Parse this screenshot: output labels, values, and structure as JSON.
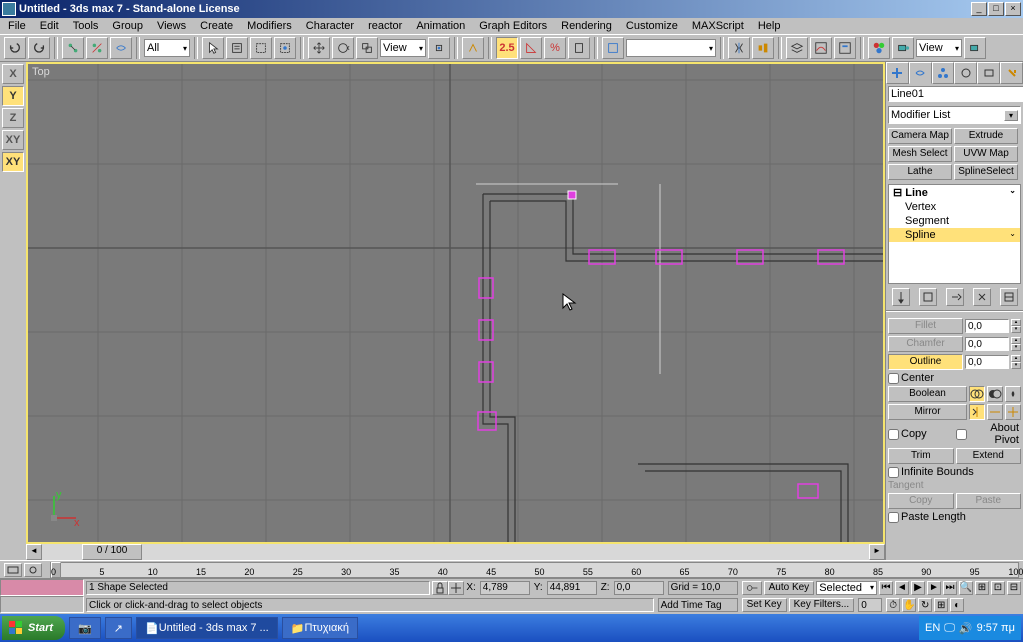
{
  "title": "Untitled - 3ds max 7  - Stand-alone License",
  "menus": [
    "File",
    "Edit",
    "Tools",
    "Group",
    "Views",
    "Create",
    "Modifiers",
    "Character",
    "reactor",
    "Animation",
    "Graph Editors",
    "Rendering",
    "Customize",
    "MAXScript",
    "Help"
  ],
  "toolbar": {
    "sets_dropdown": "All",
    "view_dropdown1": "View",
    "snap_value": "2.5",
    "named_selection": "",
    "view_dropdown2": "View"
  },
  "axis_buttons": [
    "X",
    "Y",
    "Z",
    "XY",
    "XY"
  ],
  "viewport": {
    "label": "Top"
  },
  "command_panel": {
    "object_name": "Line01",
    "modifier_list_label": "Modifier List",
    "quick_buttons": [
      "Camera Map",
      "Extrude",
      "Mesh Select",
      "UVW Map",
      "Lathe",
      "SplineSelect"
    ],
    "stack": {
      "root": "Line",
      "items": [
        "Vertex",
        "Segment",
        "Spline"
      ],
      "selected": "Spline"
    },
    "fillet": {
      "label": "Fillet",
      "value": "0,0"
    },
    "chamfer": {
      "label": "Chamfer",
      "value": "0,0"
    },
    "outline": {
      "label": "Outline",
      "value": "0,0"
    },
    "center": "Center",
    "boolean": "Boolean",
    "mirror": "Mirror",
    "copy": "Copy",
    "about_pivot": "About Pivot",
    "trim": "Trim",
    "extend": "Extend",
    "infinite_bounds": "Infinite Bounds",
    "tangent": "Tangent",
    "tangent_copy": "Copy",
    "tangent_paste": "Paste",
    "paste_length": "Paste Length"
  },
  "hscroll": {
    "label": "0 / 100"
  },
  "timeline": {
    "ticks": [
      0,
      5,
      10,
      15,
      20,
      25,
      30,
      35,
      40,
      45,
      50,
      55,
      60,
      65,
      70,
      75,
      80,
      85,
      90,
      95,
      100
    ]
  },
  "status": {
    "selection": "1 Shape Selected",
    "prompt": "Click or click-and-drag to select objects",
    "x_label": "X:",
    "x": "4,789",
    "y_label": "Y:",
    "y": "44,891",
    "z_label": "Z:",
    "z": "0,0",
    "grid": "Grid = 10,0",
    "add_time_tag": "Add Time Tag",
    "auto_key": "Auto Key",
    "set_key": "Set Key",
    "selected": "Selected",
    "key_filters": "Key Filters..."
  },
  "taskbar": {
    "start": "Start",
    "items": [
      "Untitled - 3ds max 7 ...",
      "Πτυχιακή"
    ],
    "lang": "EN",
    "time": "9:57 πμ"
  }
}
